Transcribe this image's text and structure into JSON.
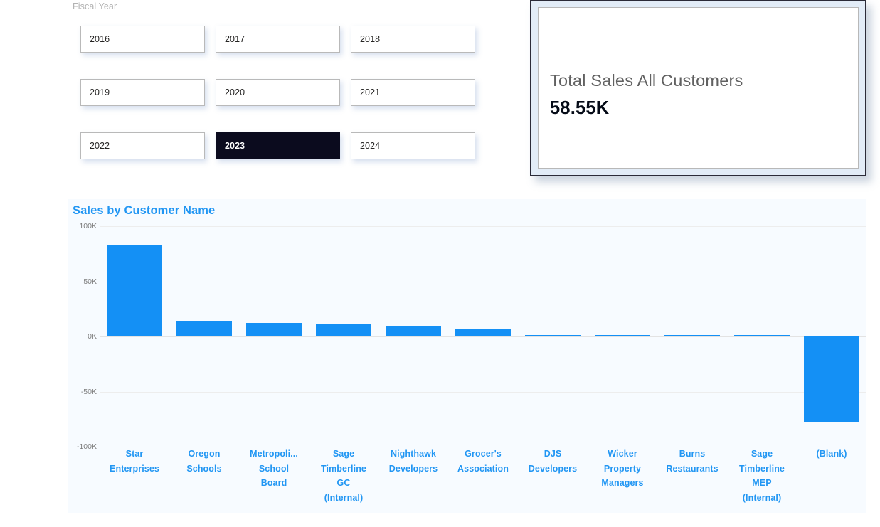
{
  "slicer": {
    "title": "Fiscal Year",
    "selected": "2023",
    "options": [
      {
        "label": "2016",
        "selected": false
      },
      {
        "label": "2017",
        "selected": false
      },
      {
        "label": "2018",
        "selected": false
      },
      {
        "label": "2019",
        "selected": false
      },
      {
        "label": "2020",
        "selected": false
      },
      {
        "label": "2021",
        "selected": false
      },
      {
        "label": "2022",
        "selected": false
      },
      {
        "label": "2023",
        "selected": true
      },
      {
        "label": "2024",
        "selected": false
      }
    ]
  },
  "kpi": {
    "label": "Total Sales All Customers",
    "value": "58.55K"
  },
  "colors": {
    "accent": "#2196f3",
    "bar": "#1490f5",
    "selected_tile_bg": "#0b0b1e",
    "panel_bg": "#f7fbff",
    "axis_text": "#7c7c7c"
  },
  "chart_data": {
    "type": "bar",
    "title": "Sales by Customer Name",
    "xlabel": "",
    "ylabel": "",
    "ylim": [
      -100000,
      100000
    ],
    "ytick_labels": [
      "100K",
      "50K",
      "0K",
      "-50K",
      "-100K"
    ],
    "yticks": [
      100000,
      50000,
      0,
      -50000,
      -100000
    ],
    "grid": true,
    "legend": false,
    "categories": [
      "Star Enterprises",
      "Oregon Schools",
      "Metropoli... School Board",
      "Sage Timberline GC (Internal)",
      "Nighthawk Developers",
      "Grocer's Association",
      "DJS Developers",
      "Wicker Property Managers",
      "Burns Restaurants",
      "Sage Timberline MEP (Internal)",
      "(Blank)"
    ],
    "category_lines": [
      [
        "Star",
        "Enterprises"
      ],
      [
        "Oregon",
        "Schools"
      ],
      [
        "Metropoli...",
        "School",
        "Board"
      ],
      [
        "Sage",
        "Timberline",
        "GC",
        "(Internal)"
      ],
      [
        "Nighthawk",
        "Developers"
      ],
      [
        "Grocer's",
        "Association"
      ],
      [
        "DJS",
        "Developers"
      ],
      [
        "Wicker",
        "Property",
        "Managers"
      ],
      [
        "Burns",
        "Restaurants"
      ],
      [
        "Sage",
        "Timberline",
        "MEP",
        "(Internal)"
      ],
      [
        "(Blank)"
      ]
    ],
    "values": [
      83500,
      14000,
      12000,
      11000,
      10000,
      7000,
      1600,
      1500,
      1200,
      1200,
      -78000
    ]
  }
}
